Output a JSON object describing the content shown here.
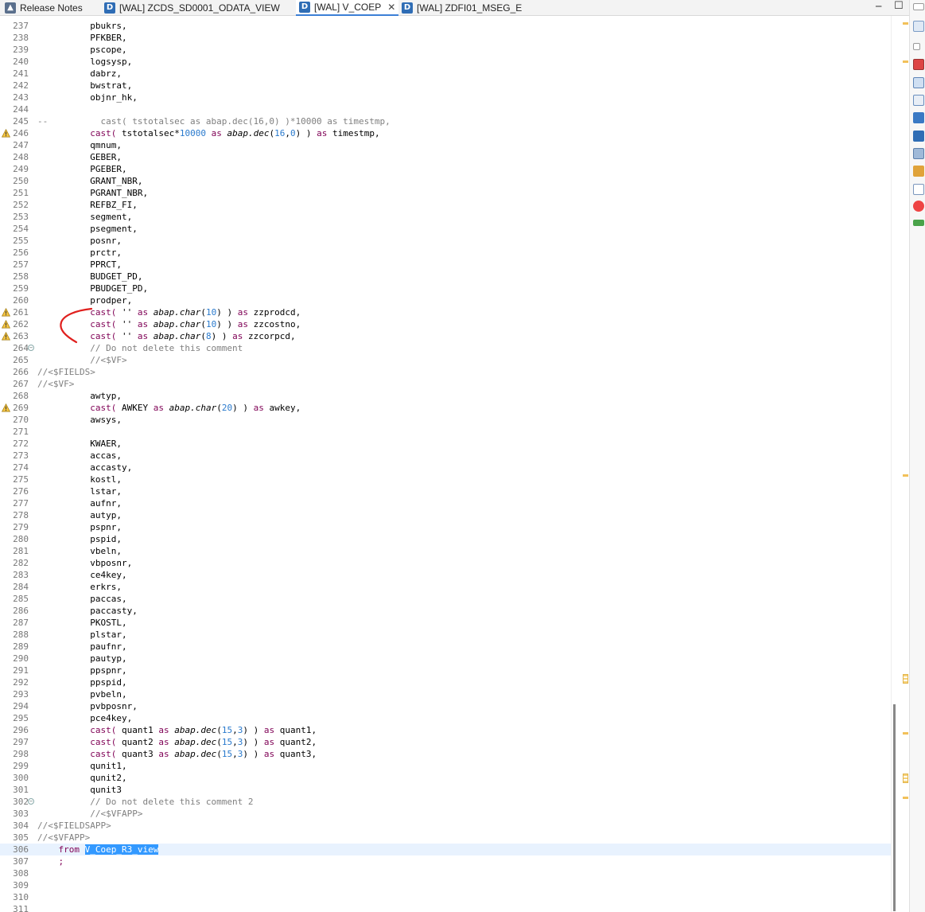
{
  "tabs": [
    {
      "label": "Release Notes",
      "icon": "release-notes-icon",
      "active": false
    },
    {
      "label": "[WAL] ZCDS_SD0001_ODATA_VIEW",
      "icon": "ddl-icon",
      "active": false
    },
    {
      "label": "[WAL] V_COEP",
      "icon": "ddl-warning-icon",
      "active": true
    },
    {
      "label": "[WAL] ZDFI01_MSEG_E",
      "icon": "ddl-icon",
      "active": false
    }
  ],
  "colors": {
    "keyword": "#7f0055",
    "number": "#2a7acd",
    "comment": "#7f7f7f",
    "selection": "#3399ff",
    "current_line": "#e8f2fe",
    "annotation": "#e0201e"
  },
  "editor": {
    "lines": [
      {
        "n": "237",
        "text": "          pbukrs,"
      },
      {
        "n": "238",
        "text": "          PFKBER,"
      },
      {
        "n": "239",
        "text": "          pscope,"
      },
      {
        "n": "240",
        "text": "          logsysp,"
      },
      {
        "n": "241",
        "text": "          dabrz,"
      },
      {
        "n": "242",
        "text": "          bwstrat,"
      },
      {
        "n": "243",
        "text": "          objnr_hk,"
      },
      {
        "n": "244",
        "text": ""
      },
      {
        "n": "245",
        "text": "--          cast( tstotalsec as abap.dec(16,0) )*10000 as timestmp,",
        "comment": true
      },
      {
        "n": "246",
        "warn": true,
        "tokens": [
          [
            "          ",
            ""
          ],
          [
            "cast(",
            "kw"
          ],
          [
            " tstotalsec",
            ""
          ],
          [
            "*",
            ""
          ],
          [
            "10000",
            "num"
          ],
          [
            " as ",
            "kw"
          ],
          [
            "abap.",
            "type"
          ],
          [
            "dec",
            "type"
          ],
          [
            "(",
            ""
          ],
          [
            "16",
            "num"
          ],
          [
            ",",
            ""
          ],
          [
            "0",
            "num"
          ],
          [
            ") ) ",
            ""
          ],
          [
            "as",
            "kw"
          ],
          [
            " timestmp,",
            ""
          ]
        ]
      },
      {
        "n": "247",
        "text": "          qmnum,"
      },
      {
        "n": "248",
        "text": "          GEBER,"
      },
      {
        "n": "249",
        "text": "          PGEBER,"
      },
      {
        "n": "250",
        "text": "          GRANT_NBR,"
      },
      {
        "n": "251",
        "text": "          PGRANT_NBR,"
      },
      {
        "n": "252",
        "text": "          REFBZ_FI,"
      },
      {
        "n": "253",
        "text": "          segment,"
      },
      {
        "n": "254",
        "text": "          psegment,"
      },
      {
        "n": "255",
        "text": "          posnr,"
      },
      {
        "n": "256",
        "text": "          prctr,"
      },
      {
        "n": "257",
        "text": "          PPRCT,"
      },
      {
        "n": "258",
        "text": "          BUDGET_PD,"
      },
      {
        "n": "259",
        "text": "          PBUDGET_PD,"
      },
      {
        "n": "260",
        "text": "          prodper,"
      },
      {
        "n": "261",
        "warn": true,
        "tokens": [
          [
            "          ",
            ""
          ],
          [
            "cast(",
            "kw"
          ],
          [
            " '' ",
            ""
          ],
          [
            "as",
            "kw"
          ],
          [
            " ",
            ""
          ],
          [
            "abap.",
            "type"
          ],
          [
            "char",
            "type"
          ],
          [
            "(",
            ""
          ],
          [
            "10",
            "num"
          ],
          [
            ") ) ",
            ""
          ],
          [
            "as",
            "kw"
          ],
          [
            " zzprodcd,",
            ""
          ]
        ]
      },
      {
        "n": "262",
        "warn": true,
        "tokens": [
          [
            "          ",
            ""
          ],
          [
            "cast(",
            "kw"
          ],
          [
            " '' ",
            ""
          ],
          [
            "as",
            "kw"
          ],
          [
            " ",
            ""
          ],
          [
            "abap.",
            "type"
          ],
          [
            "char",
            "type"
          ],
          [
            "(",
            ""
          ],
          [
            "10",
            "num"
          ],
          [
            ") ) ",
            ""
          ],
          [
            "as",
            "kw"
          ],
          [
            " zzcostno,",
            ""
          ]
        ]
      },
      {
        "n": "263",
        "warn": true,
        "tokens": [
          [
            "          ",
            ""
          ],
          [
            "cast(",
            "kw"
          ],
          [
            " '' ",
            ""
          ],
          [
            "as",
            "kw"
          ],
          [
            " ",
            ""
          ],
          [
            "abap.",
            "type"
          ],
          [
            "char",
            "type"
          ],
          [
            "(",
            ""
          ],
          [
            "8",
            "num"
          ],
          [
            ") ) ",
            ""
          ],
          [
            "as",
            "kw"
          ],
          [
            " zzcorpcd,",
            ""
          ]
        ]
      },
      {
        "n": "264",
        "fold": true,
        "text": "          // Do not delete this comment",
        "comment": true
      },
      {
        "n": "265",
        "text": "          //<$VF>",
        "comment": true
      },
      {
        "n": "266",
        "text": "//<$FIELDS>",
        "comment": true
      },
      {
        "n": "267",
        "text": "//<$VF>",
        "comment": true
      },
      {
        "n": "268",
        "text": "          awtyp,"
      },
      {
        "n": "269",
        "warn": true,
        "tokens": [
          [
            "          ",
            ""
          ],
          [
            "cast(",
            "kw"
          ],
          [
            " AWKEY ",
            ""
          ],
          [
            "as",
            "kw"
          ],
          [
            " ",
            ""
          ],
          [
            "abap.",
            "type"
          ],
          [
            "char",
            "type"
          ],
          [
            "(",
            ""
          ],
          [
            "20",
            "num"
          ],
          [
            ") ) ",
            ""
          ],
          [
            "as",
            "kw"
          ],
          [
            " awkey,",
            ""
          ]
        ]
      },
      {
        "n": "270",
        "text": "          awsys,"
      },
      {
        "n": "271",
        "text": ""
      },
      {
        "n": "272",
        "text": "          KWAER,"
      },
      {
        "n": "273",
        "text": "          accas,"
      },
      {
        "n": "274",
        "text": "          accasty,"
      },
      {
        "n": "275",
        "text": "          kostl,"
      },
      {
        "n": "276",
        "text": "          lstar,"
      },
      {
        "n": "277",
        "text": "          aufnr,"
      },
      {
        "n": "278",
        "text": "          autyp,"
      },
      {
        "n": "279",
        "text": "          pspnr,"
      },
      {
        "n": "280",
        "text": "          pspid,"
      },
      {
        "n": "281",
        "text": "          vbeln,"
      },
      {
        "n": "282",
        "text": "          vbposnr,"
      },
      {
        "n": "283",
        "text": "          ce4key,"
      },
      {
        "n": "284",
        "text": "          erkrs,"
      },
      {
        "n": "285",
        "text": "          paccas,"
      },
      {
        "n": "286",
        "text": "          paccasty,"
      },
      {
        "n": "287",
        "text": "          PKOSTL,"
      },
      {
        "n": "288",
        "text": "          plstar,"
      },
      {
        "n": "289",
        "text": "          paufnr,"
      },
      {
        "n": "290",
        "text": "          pautyp,"
      },
      {
        "n": "291",
        "text": "          ppspnr,"
      },
      {
        "n": "292",
        "text": "          ppspid,"
      },
      {
        "n": "293",
        "text": "          pvbeln,"
      },
      {
        "n": "294",
        "text": "          pvbposnr,"
      },
      {
        "n": "295",
        "text": "          pce4key,"
      },
      {
        "n": "296",
        "tokens": [
          [
            "          ",
            ""
          ],
          [
            "cast(",
            "kw"
          ],
          [
            " quant1 ",
            ""
          ],
          [
            "as",
            "kw"
          ],
          [
            " ",
            ""
          ],
          [
            "abap.",
            "type"
          ],
          [
            "dec",
            "type"
          ],
          [
            "(",
            ""
          ],
          [
            "15",
            "num"
          ],
          [
            ",",
            ""
          ],
          [
            "3",
            "num"
          ],
          [
            ") ) ",
            ""
          ],
          [
            "as",
            "kw"
          ],
          [
            " quant1,",
            ""
          ]
        ]
      },
      {
        "n": "297",
        "tokens": [
          [
            "          ",
            ""
          ],
          [
            "cast(",
            "kw"
          ],
          [
            " quant2 ",
            ""
          ],
          [
            "as",
            "kw"
          ],
          [
            " ",
            ""
          ],
          [
            "abap.",
            "type"
          ],
          [
            "dec",
            "type"
          ],
          [
            "(",
            ""
          ],
          [
            "15",
            "num"
          ],
          [
            ",",
            ""
          ],
          [
            "3",
            "num"
          ],
          [
            ") ) ",
            ""
          ],
          [
            "as",
            "kw"
          ],
          [
            " quant2,",
            ""
          ]
        ]
      },
      {
        "n": "298",
        "tokens": [
          [
            "          ",
            ""
          ],
          [
            "cast(",
            "kw"
          ],
          [
            " quant3 ",
            ""
          ],
          [
            "as",
            "kw"
          ],
          [
            " ",
            ""
          ],
          [
            "abap.",
            "type"
          ],
          [
            "dec",
            "type"
          ],
          [
            "(",
            ""
          ],
          [
            "15",
            "num"
          ],
          [
            ",",
            ""
          ],
          [
            "3",
            "num"
          ],
          [
            ") ) ",
            ""
          ],
          [
            "as",
            "kw"
          ],
          [
            " quant3,",
            ""
          ]
        ]
      },
      {
        "n": "299",
        "text": "          qunit1,"
      },
      {
        "n": "300",
        "text": "          qunit2,"
      },
      {
        "n": "301",
        "text": "          qunit3"
      },
      {
        "n": "302",
        "fold": true,
        "text": "          // Do not delete this comment 2",
        "comment": true
      },
      {
        "n": "303",
        "text": "          //<$VFAPP>",
        "comment": true
      },
      {
        "n": "304",
        "text": "//<$FIELDSAPP>",
        "comment": true
      },
      {
        "n": "305",
        "text": "//<$VFAPP>",
        "comment": true
      },
      {
        "n": "306",
        "current": true,
        "tokens": [
          [
            "    ",
            ""
          ],
          [
            "from",
            "kw"
          ],
          [
            " ",
            ""
          ],
          [
            "V_Coep_R3_view",
            "sel"
          ]
        ]
      },
      {
        "n": "307",
        "tokens": [
          [
            "    ",
            ""
          ],
          [
            ";",
            "kw"
          ]
        ]
      },
      {
        "n": "308",
        "text": ""
      },
      {
        "n": "309",
        "text": ""
      },
      {
        "n": "310",
        "text": ""
      },
      {
        "n": "311",
        "text": ""
      }
    ]
  }
}
